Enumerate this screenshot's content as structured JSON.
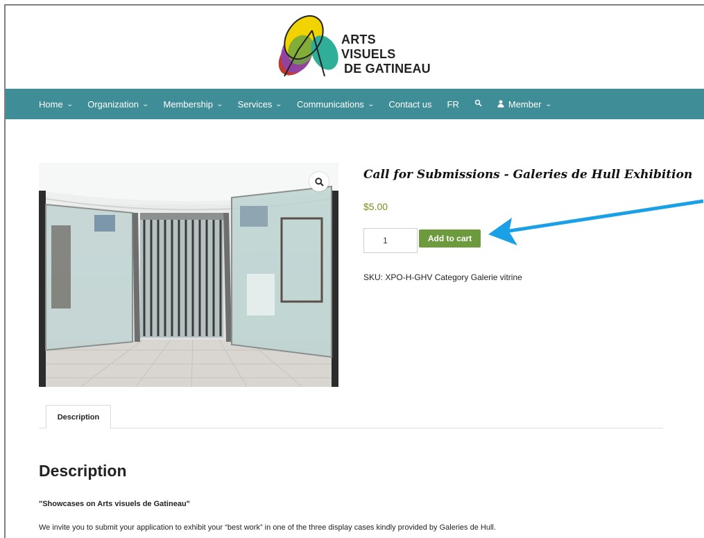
{
  "brand": {
    "logo_lines": [
      "ARTS",
      "VISUELS",
      "DE GATINEAU"
    ]
  },
  "nav": {
    "items": [
      {
        "label": "Home",
        "has_dropdown": true
      },
      {
        "label": "Organization",
        "has_dropdown": true
      },
      {
        "label": "Membership",
        "has_dropdown": true
      },
      {
        "label": "Services",
        "has_dropdown": true
      },
      {
        "label": "Communications",
        "has_dropdown": true
      },
      {
        "label": "Contact us",
        "has_dropdown": false
      },
      {
        "label": "FR",
        "has_dropdown": false
      }
    ],
    "search_icon": "search-icon",
    "member": {
      "label": "Member",
      "icon": "user-icon"
    },
    "background_color": "#3f8d96"
  },
  "product": {
    "title": "Call for Submissions - Galeries de Hull Exhibition",
    "price": "$5.00",
    "price_color": "#7a8d1d",
    "quantity": "1",
    "add_to_cart_label": "Add to cart",
    "add_to_cart_color": "#6d9a3d",
    "sku_label": "SKU:",
    "sku": "XPO-H-GHV",
    "category_label": "Category",
    "category": "Galerie vitrine",
    "image_icon": "zoom-icon"
  },
  "annotation": {
    "arrow_color": "#1aa0e6"
  },
  "tabs": [
    {
      "label": "Description",
      "active": true
    }
  ],
  "description": {
    "heading": "Description",
    "subtitle": "\"Showcases on Arts visuels de Gatineau\"",
    "body": "We invite you to submit your application to exhibit your “best work” in one of the three display cases kindly provided by Galeries de Hull."
  }
}
